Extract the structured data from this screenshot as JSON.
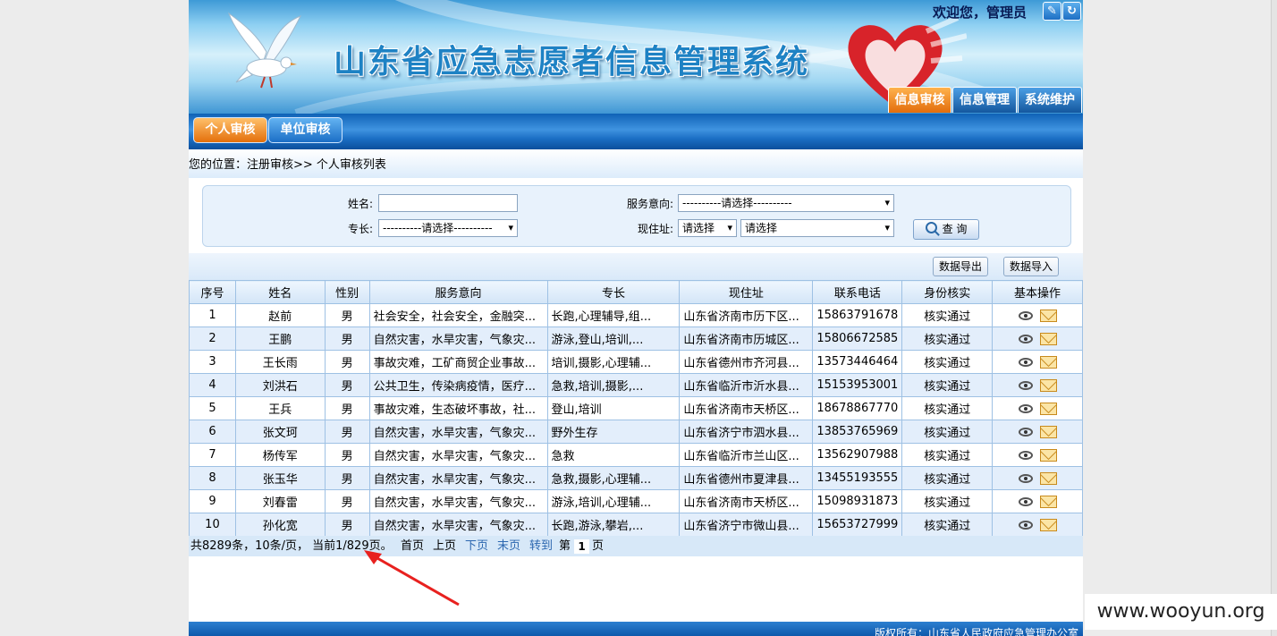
{
  "header": {
    "title": "山东省应急志愿者信息管理系统",
    "welcome": "欢迎您，管理员",
    "edit_icon": "✎",
    "logout_icon": "↻",
    "main_tabs": [
      "信息审核",
      "信息管理",
      "系统维护"
    ],
    "active_tab": "信息审核",
    "accent_color": "#e36d0c"
  },
  "subnav": {
    "personal_label": "个人审核",
    "unit_label": "单位审核"
  },
  "breadcrumb": "您的位置：注册审核>> 个人审核列表",
  "search": {
    "name_label": "姓名:",
    "name_value": "",
    "service_label": "服务意向:",
    "service_value": "----------请选择----------",
    "skill_label": "专长:",
    "skill_value": "----------请选择----------",
    "address_label": "现住址:",
    "address_city": "请选择",
    "address_county": "请选择",
    "search_button": "查 询"
  },
  "toolbar": {
    "export_label": "数据导出",
    "import_label": "数据导入"
  },
  "table": {
    "columns": [
      "序号",
      "姓名",
      "性别",
      "服务意向",
      "专长",
      "现住址",
      "联系电话",
      "身份核实",
      "基本操作"
    ],
    "rows": [
      {
        "no": "1",
        "name": "赵前",
        "gender": "男",
        "service": "社会安全，社会安全，金融突...",
        "skill": "长跑,心理辅导,组...",
        "address": "山东省济南市历下区...",
        "phone": "15863791678",
        "verify": "核实通过"
      },
      {
        "no": "2",
        "name": "王鹏",
        "gender": "男",
        "service": "自然灾害，水旱灾害，气象灾...",
        "skill": "游泳,登山,培训,...",
        "address": "山东省济南市历城区...",
        "phone": "15806672585",
        "verify": "核实通过"
      },
      {
        "no": "3",
        "name": "王长雨",
        "gender": "男",
        "service": "事故灾难，工矿商贸企业事故...",
        "skill": "培训,摄影,心理辅...",
        "address": "山东省德州市齐河县...",
        "phone": "13573446464",
        "verify": "核实通过"
      },
      {
        "no": "4",
        "name": "刘洪石",
        "gender": "男",
        "service": "公共卫生，传染病疫情，医疗...",
        "skill": "急救,培训,摄影,...",
        "address": "山东省临沂市沂水县...",
        "phone": "15153953001",
        "verify": "核实通过"
      },
      {
        "no": "5",
        "name": "王兵",
        "gender": "男",
        "service": "事故灾难，生态破坏事故，社...",
        "skill": "登山,培训",
        "address": "山东省济南市天桥区...",
        "phone": "18678867770",
        "verify": "核实通过"
      },
      {
        "no": "6",
        "name": "张文珂",
        "gender": "男",
        "service": "自然灾害，水旱灾害，气象灾...",
        "skill": "野外生存",
        "address": "山东省济宁市泗水县...",
        "phone": "13853765969",
        "verify": "核实通过"
      },
      {
        "no": "7",
        "name": "杨传军",
        "gender": "男",
        "service": "自然灾害，水旱灾害，气象灾...",
        "skill": "急救",
        "address": "山东省临沂市兰山区...",
        "phone": "13562907988",
        "verify": "核实通过"
      },
      {
        "no": "8",
        "name": "张玉华",
        "gender": "男",
        "service": "自然灾害，水旱灾害，气象灾...",
        "skill": "急救,摄影,心理辅...",
        "address": "山东省德州市夏津县...",
        "phone": "13455193555",
        "verify": "核实通过"
      },
      {
        "no": "9",
        "name": "刘春雷",
        "gender": "男",
        "service": "自然灾害，水旱灾害，气象灾...",
        "skill": "游泳,培训,心理辅...",
        "address": "山东省济南市天桥区...",
        "phone": "15098931873",
        "verify": "核实通过"
      },
      {
        "no": "10",
        "name": "孙化宽",
        "gender": "男",
        "service": "自然灾害，水旱灾害，气象灾...",
        "skill": "长跑,游泳,攀岩,...",
        "address": "山东省济宁市微山县...",
        "phone": "15653727999",
        "verify": "核实通过"
      }
    ]
  },
  "pager": {
    "summary": "共8289条，10条/页，  当前1/829页。",
    "first": "首页",
    "prev": "上页",
    "next": "下页",
    "last": "末页",
    "goto": "转到",
    "page_prefix": "第",
    "page_value": "1",
    "page_suffix": "页"
  },
  "footer": "版权所有：山东省人民政府应急管理办公室",
  "watermark": "www.wooyun.org"
}
